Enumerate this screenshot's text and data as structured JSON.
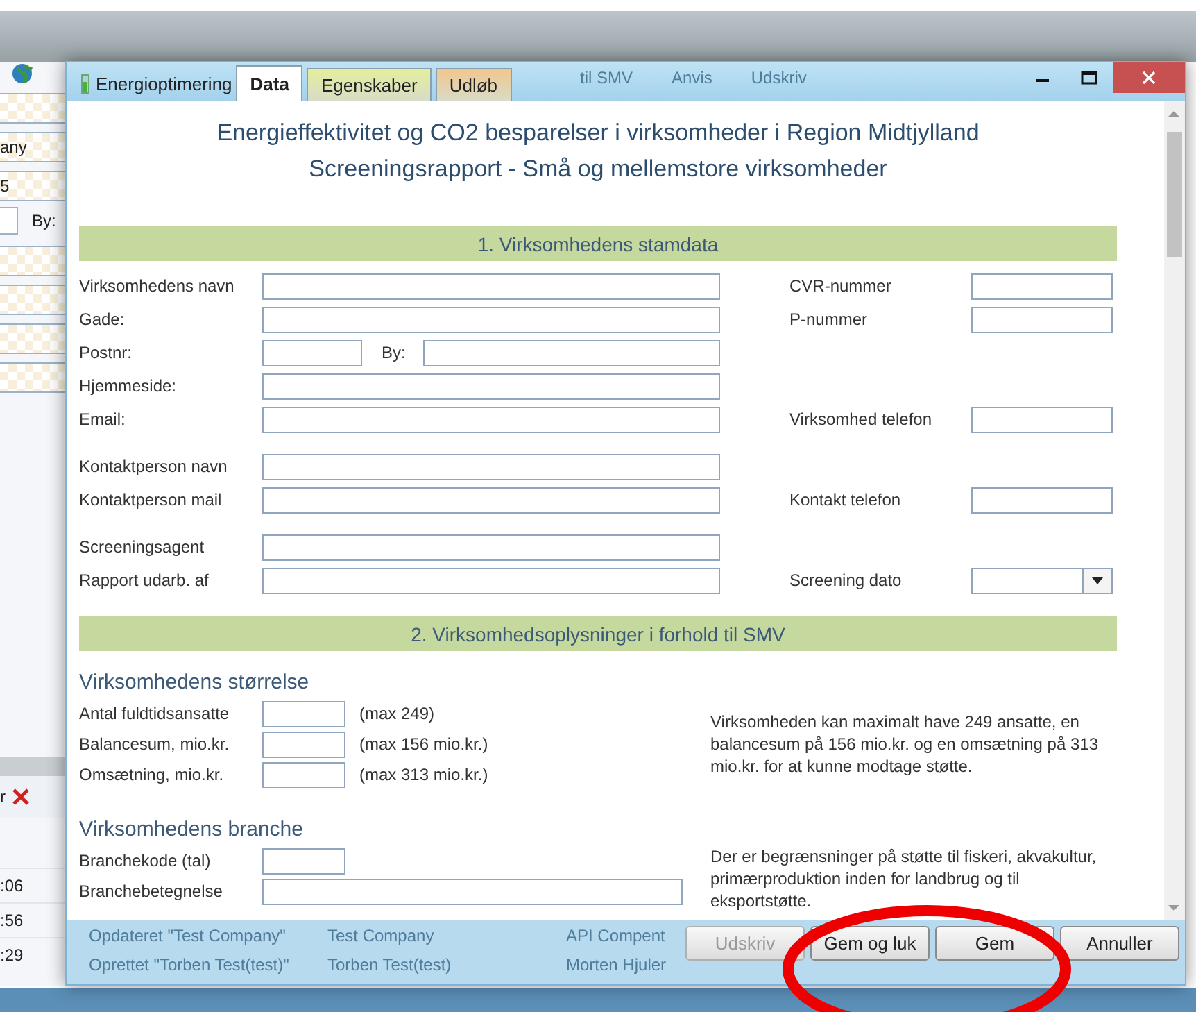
{
  "background_app": {
    "toolbar_ghost": [
      "til SMV",
      "Anvis",
      "Udskriv"
    ],
    "side_fields": [
      "any",
      "5"
    ],
    "side_label": "By:",
    "side_button_text": "r",
    "times": [
      ":06",
      ":56",
      ":29"
    ]
  },
  "dialog": {
    "title": "Energioptimering",
    "tabs": [
      {
        "label": "Data",
        "selected": true,
        "color": "#ffffff"
      },
      {
        "label": "Egenskaber",
        "selected": false,
        "color": "#e4ee9c"
      },
      {
        "label": "Udløb",
        "selected": false,
        "color": "#f1c78e"
      }
    ],
    "heading": [
      "Energieffektivitet og CO2 besparelser i virksomheder i Region Midtjylland",
      "Screeningsrapport - Små og mellemstore virksomheder"
    ],
    "section_1": {
      "title": "1. Virksomhedens stamdata",
      "groups": [
        [
          {
            "kind": "wide",
            "label": "Virksomhedens navn",
            "right": {
              "kind": "text",
              "label": "CVR-nummer"
            }
          },
          {
            "kind": "wide",
            "label": "Gade:",
            "right": {
              "kind": "text",
              "label": "P-nummer"
            }
          },
          {
            "kind": "postal",
            "label": "Postnr:",
            "city_label": "By:"
          },
          {
            "kind": "wide",
            "label": "Hjemmeside:"
          },
          {
            "kind": "wide",
            "label": "Email:",
            "right": {
              "kind": "text",
              "label": "Virksomhed telefon"
            }
          }
        ],
        [
          {
            "kind": "wide",
            "label": "Kontaktperson navn"
          },
          {
            "kind": "wide",
            "label": "Kontaktperson mail",
            "right": {
              "kind": "text",
              "label": "Kontakt telefon"
            }
          }
        ],
        [
          {
            "kind": "wide",
            "label": "Screeningsagent"
          },
          {
            "kind": "wide",
            "label": "Rapport udarb. af",
            "right": {
              "kind": "dropdown",
              "label": "Screening dato"
            }
          }
        ]
      ]
    },
    "section_2": {
      "title": "2. Virksomhedsoplysninger i forhold til SMV",
      "subsections": [
        {
          "heading": "Virksomhedens størrelse",
          "rows": [
            {
              "kind": "short",
              "label": "Antal fuldtidsansatte",
              "note": "(max 249)"
            },
            {
              "kind": "short",
              "label": "Balancesum, mio.kr.",
              "note": "(max 156 mio.kr.)"
            },
            {
              "kind": "short",
              "label": "Omsætning, mio.kr.",
              "note": "(max 313 mio.kr.)"
            }
          ],
          "info": "Virksomheden kan maximalt have 249 ansatte, en balancesum på 156 mio.kr. og en omsætning på 313 mio.kr. for at kunne modtage støtte."
        },
        {
          "heading": "Virksomhedens branche",
          "rows": [
            {
              "kind": "short",
              "label": "Branchekode (tal)"
            },
            {
              "kind": "long",
              "label": "Branchebetegnelse"
            }
          ],
          "info": "Der er begrænsninger på støtte til fiskeri, akvakultur, primærproduktion inden for landbrug og til eksportstøtte."
        }
      ]
    },
    "ghost_rows": [
      [
        "Opdateret \"Test Company\"",
        "Test Company",
        "API Compent"
      ],
      [
        "Oprettet \"Torben Test(test)\"",
        "Torben Test(test)",
        "Morten Hjuler"
      ]
    ],
    "buttons": [
      {
        "label": "Udskriv",
        "disabled": true
      },
      {
        "label": "Gem og luk",
        "disabled": false
      },
      {
        "label": "Gem",
        "disabled": false
      },
      {
        "label": "Annuller",
        "disabled": false
      }
    ]
  },
  "annotation": {
    "kind": "circle"
  }
}
